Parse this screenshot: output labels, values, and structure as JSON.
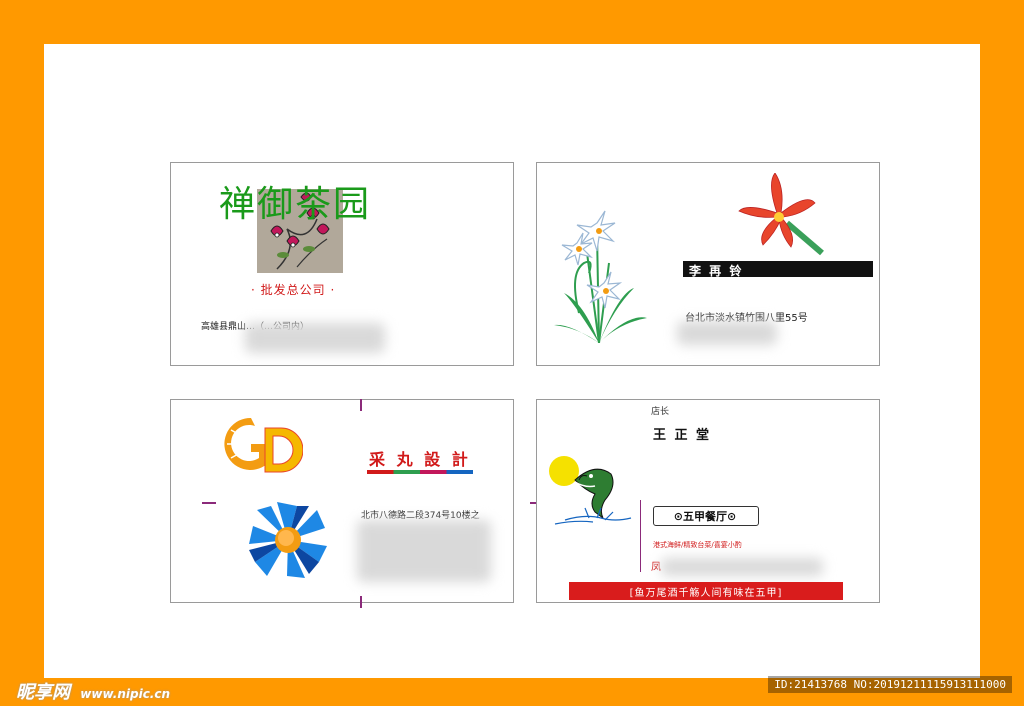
{
  "colors": {
    "frame": "#FF9900",
    "green": "#1a9a1a",
    "red": "#d11a1a",
    "orange": "#f39c12",
    "blue": "#1565c0"
  },
  "card1": {
    "title": "禅御茶园",
    "subtitle": "· 批发总公司 ·",
    "address": "高雄县鼎山…（…公司内）",
    "icon": "flower-tile-icon"
  },
  "card2": {
    "name": "李 再 铃",
    "address": "台北市淡水镇竹围八里55号",
    "icons": [
      "daffodil-icon",
      "orchid-icon"
    ]
  },
  "card3": {
    "brand": "采 丸 設 計",
    "address": "北市八德路二段374号10楼之",
    "icons": [
      "gd-logo-icon",
      "sunburst-icon"
    ]
  },
  "card4": {
    "role": "店长",
    "name": "王 正 堂",
    "restaurant": "⊙五甲餐厅⊙",
    "services": "港式海鲜/精致台菜/喜宴小酌",
    "address_prefix": "凤",
    "slogan": "[鱼万尾酒千觞人间有味在五甲]",
    "icons": [
      "sun-icon",
      "dolphin-icon"
    ]
  },
  "watermark": {
    "logo": "昵享网",
    "url": "www.nipic.cn",
    "id": "ID:21413768 NO:20191211115913111000"
  }
}
